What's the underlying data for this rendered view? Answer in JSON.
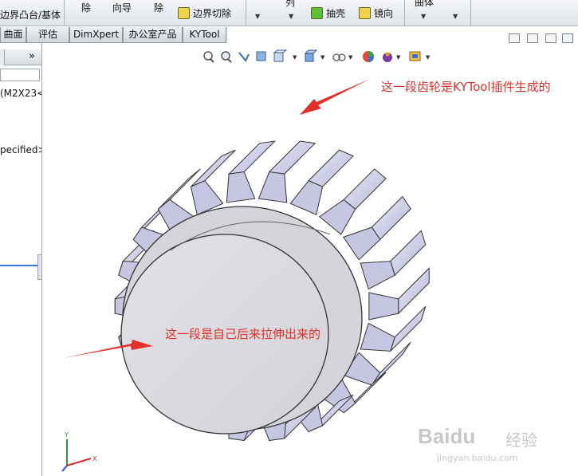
{
  "ribbon": {
    "boundary_boss": "边界凸台/基体",
    "chu1": "除",
    "wizard": "向导",
    "chu2": "除",
    "boundary_cut": "边界切除",
    "lie": "列",
    "shell": "抽壳",
    "mirror": "镜向",
    "curves": "曲体"
  },
  "tabs": [
    {
      "label": "曲面"
    },
    {
      "label": "评估"
    },
    {
      "label": "DimXpert"
    },
    {
      "label": "办公室产品"
    },
    {
      "label": "KYTool"
    }
  ],
  "left_panel": {
    "expand": "»",
    "item_1": "(M2X23<",
    "item_2": "pecified>"
  },
  "annotations": {
    "top": "这一段齿轮是KYTool插件生成的",
    "middle": "这一段是自己后来拉伸出来的"
  },
  "watermark": {
    "brand": "Baidu",
    "subtitle": "经验",
    "url": "jingyan.baidu.com"
  },
  "colors": {
    "annotation": "#e0302a",
    "gear_face": "#dddde2",
    "gear_teeth": "#c4c4e4"
  }
}
